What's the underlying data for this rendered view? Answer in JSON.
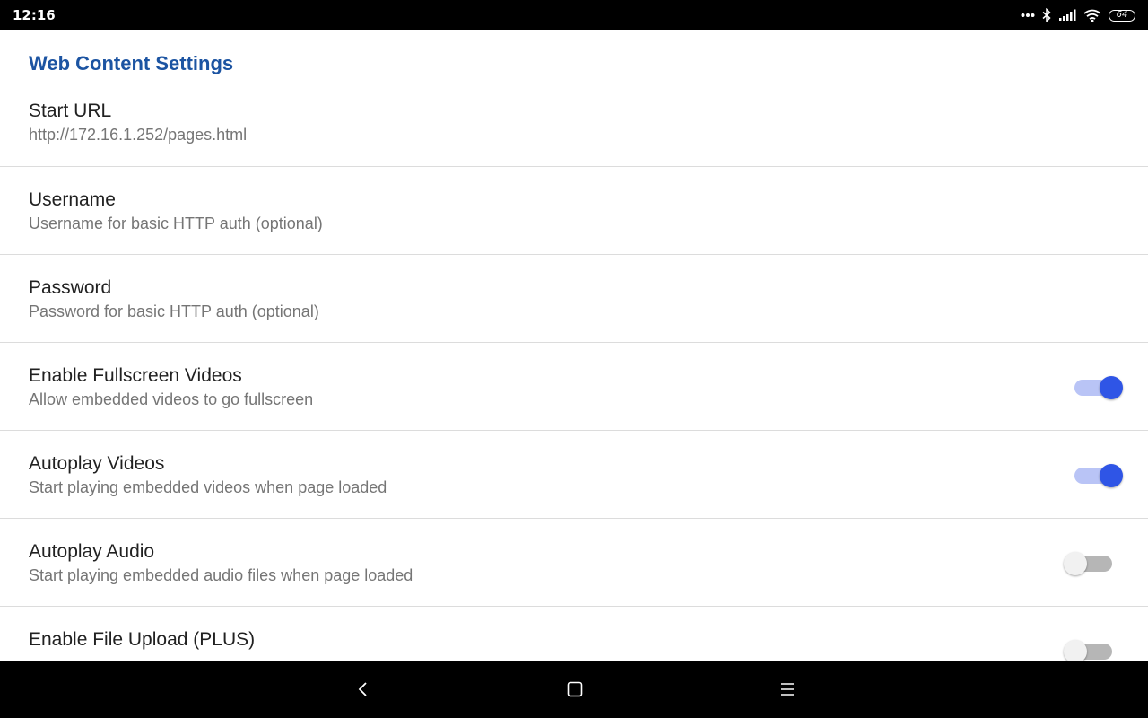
{
  "status_bar": {
    "time": "12:16",
    "battery_level": "64",
    "icons": [
      "more-dots-icon",
      "bluetooth-icon",
      "signal-icon",
      "wifi-icon",
      "battery-icon"
    ]
  },
  "settings": {
    "section_title": "Web Content Settings",
    "items": [
      {
        "title": "Start URL",
        "summary": "http://172.16.1.252/pages.html"
      },
      {
        "title": "Username",
        "summary": "Username for basic HTTP auth (optional)"
      },
      {
        "title": "Password",
        "summary": "Password for basic HTTP auth (optional)"
      },
      {
        "title": "Enable Fullscreen Videos",
        "summary": "Allow embedded videos to go fullscreen",
        "switch": "on"
      },
      {
        "title": "Autoplay Videos",
        "summary": "Start playing embedded videos when page loaded",
        "switch": "on"
      },
      {
        "title": "Autoplay Audio",
        "summary": "Start playing embedded audio files when page loaded",
        "switch": "off"
      },
      {
        "title": "Enable File Upload (PLUS)",
        "summary": "",
        "switch": "off"
      }
    ]
  },
  "nav_bar": {
    "buttons": [
      "back-icon",
      "home-icon",
      "menu-icon"
    ]
  },
  "colors": {
    "accent": "#2f55e6",
    "section_title": "#1c54a2",
    "status_bar": "#000000",
    "nav_bar": "#000000"
  }
}
